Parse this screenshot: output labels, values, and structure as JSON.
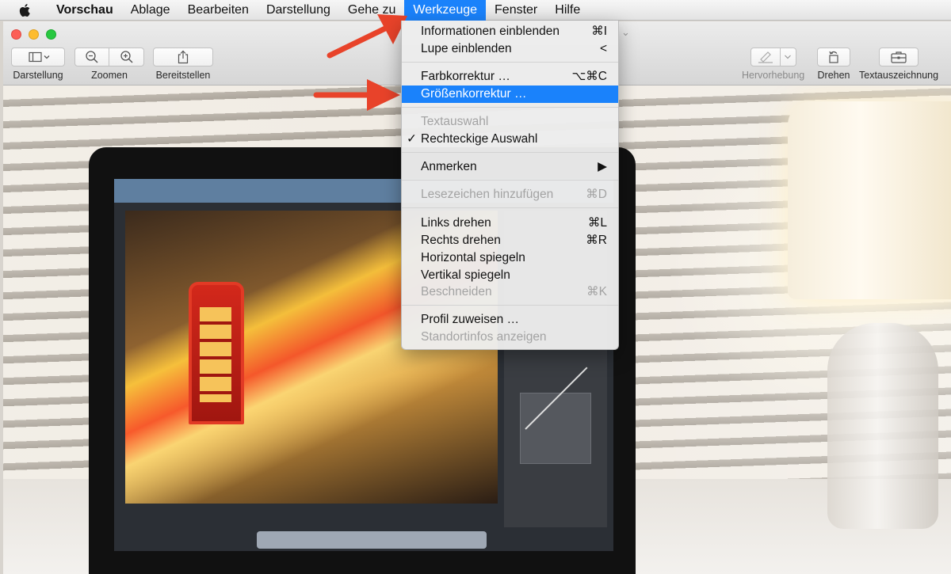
{
  "menubar": {
    "app": "Vorschau",
    "items": [
      "Ablage",
      "Bearbeiten",
      "Darstellung",
      "Gehe zu",
      "Werkzeuge",
      "Fenster",
      "Hilfe"
    ],
    "active": "Werkzeuge"
  },
  "toolbar": {
    "view_label": "Darstellung",
    "zoom_label": "Zoomen",
    "share_label": "Bereitstellen",
    "highlight_label": "Hervorhebung",
    "rotate_label": "Drehen",
    "markup_label": "Textauszeichnung"
  },
  "menu": {
    "info": {
      "label": "Informationen einblenden",
      "shortcut": "⌘I"
    },
    "loupe": {
      "label": "Lupe einblenden",
      "shortcut": "<"
    },
    "color": {
      "label": "Farbkorrektur …",
      "shortcut": "⌥⌘C"
    },
    "size": {
      "label": "Größenkorrektur …"
    },
    "textsel": {
      "label": "Textauswahl"
    },
    "rectsel": {
      "label": "Rechteckige Auswahl",
      "check": "✓"
    },
    "annotate": {
      "label": "Anmerken",
      "arrow": "▶"
    },
    "bookmark": {
      "label": "Lesezeichen hinzufügen",
      "shortcut": "⌘D"
    },
    "rotleft": {
      "label": "Links drehen",
      "shortcut": "⌘L"
    },
    "rotright": {
      "label": "Rechts drehen",
      "shortcut": "⌘R"
    },
    "fliph": {
      "label": "Horizontal spiegeln"
    },
    "flipv": {
      "label": "Vertikal spiegeln"
    },
    "crop": {
      "label": "Beschneiden",
      "shortcut": "⌘K"
    },
    "profile": {
      "label": "Profil zuweisen …"
    },
    "location": {
      "label": "Standortinfos anzeigen"
    }
  },
  "colors": {
    "highlight": "#1a82fb",
    "arrow": "#e8432a"
  }
}
